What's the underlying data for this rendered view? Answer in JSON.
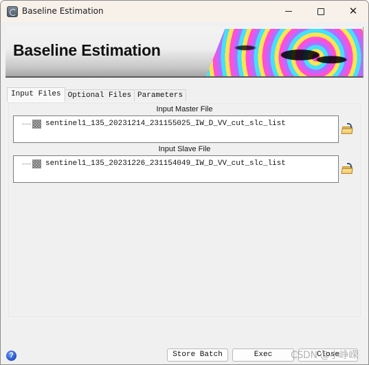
{
  "window": {
    "title": "Baseline Estimation",
    "icon": "app-logo-icon",
    "controls": {
      "minimize_icon": "minimize-icon",
      "maximize_icon": "maximize-icon",
      "close_icon": "close-icon",
      "close_glyph": "✕"
    }
  },
  "banner": {
    "title": "Baseline Estimation",
    "image": "interferogram-fringe-image"
  },
  "tabs": [
    {
      "label": "Input Files",
      "active": true
    },
    {
      "label": "Optional Files",
      "active": false
    },
    {
      "label": "Parameters",
      "active": false
    }
  ],
  "input_files": {
    "master": {
      "label": "Input Master File",
      "files": [
        "sentinel1_135_20231214_231155025_IW_D_VV_cut_slc_list"
      ],
      "browse_icon": "open-folder-icon"
    },
    "slave": {
      "label": "Input Slave File",
      "files": [
        "sentinel1_135_20231226_231154049_IW_D_VV_cut_slc_list"
      ],
      "browse_icon": "open-folder-icon"
    }
  },
  "footer": {
    "help_glyph": "?",
    "buttons": {
      "store_batch": "Store Batch",
      "exec": "Exec",
      "close": "Close"
    },
    "watermark": "CSDN @小峥嵘"
  }
}
